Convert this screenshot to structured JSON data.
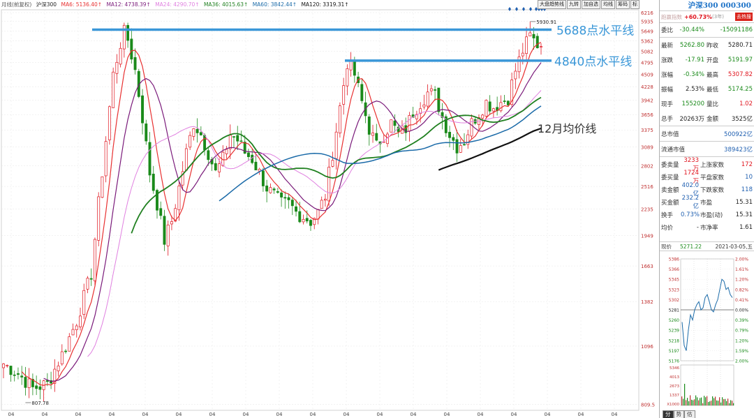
{
  "legend": {
    "label": "月线(前复权)",
    "index_name": "沪深300",
    "mas": [
      {
        "text": "MA6: 5136.40↑",
        "color": "#e83030"
      },
      {
        "text": "MA12: 4738.39↑",
        "color": "#7a1a7a"
      },
      {
        "text": "MA24: 4290.70↑",
        "color": "#e080e0"
      },
      {
        "text": "MA36: 4015.63↑",
        "color": "#208020"
      },
      {
        "text": "MA60: 3842.44↑",
        "color": "#1a6aa8"
      },
      {
        "text": "MA120: 3319.31↑",
        "color": "#111111"
      }
    ]
  },
  "toolbar": [
    "大盘趋势线",
    "九转",
    "加自选",
    "均线",
    "筹码",
    "标"
  ],
  "price_axis": [
    "6216",
    "5935",
    "5649",
    "5362",
    "5082",
    "4795",
    "4509",
    "4228",
    "3942",
    "3656",
    "3375",
    "3089",
    "2802",
    "2516",
    "2235",
    "1949",
    "1663",
    "1382",
    "1096",
    "809.5"
  ],
  "time_axis": [
    "04",
    "04",
    "04",
    "04",
    "04",
    "04",
    "04",
    "04",
    "04",
    "04",
    "04",
    "04",
    "04",
    "04",
    "04",
    "04",
    "04",
    "04",
    "04"
  ],
  "annotations": {
    "high_label": "5930.91",
    "low_label": "807.78",
    "level_1": "5688点水平线",
    "level_2": "4840点水平线",
    "ma_note": "12月均价线"
  },
  "chart_data": {
    "type": "candlestick",
    "title": "",
    "ylim": [
      807.78,
      6216
    ],
    "y_scale": "log",
    "horizontal_lines": [
      {
        "label": "5688点水平线",
        "y": 5688,
        "color": "#3a97d8"
      },
      {
        "label": "4840点水平线",
        "y": 4840,
        "color": "#3a97d8"
      }
    ],
    "extremes": {
      "high": 5930.91,
      "low": 807.78
    },
    "close_path": [
      [
        0,
        1000
      ],
      [
        4,
        950
      ],
      [
        8,
        880
      ],
      [
        12,
        900
      ],
      [
        16,
        1050
      ],
      [
        20,
        1250
      ],
      [
        24,
        1600
      ],
      [
        26,
        2300
      ],
      [
        28,
        3200
      ],
      [
        30,
        4500
      ],
      [
        32,
        5300
      ],
      [
        33,
        5600
      ],
      [
        34,
        5400
      ],
      [
        36,
        4600
      ],
      [
        38,
        3600
      ],
      [
        40,
        2700
      ],
      [
        42,
        2300
      ],
      [
        44,
        1900
      ],
      [
        46,
        2100
      ],
      [
        48,
        2500
      ],
      [
        50,
        3000
      ],
      [
        52,
        3500
      ],
      [
        54,
        3300
      ],
      [
        56,
        3000
      ],
      [
        58,
        2700
      ],
      [
        60,
        2900
      ],
      [
        62,
        3300
      ],
      [
        64,
        3200
      ],
      [
        66,
        3000
      ],
      [
        68,
        2900
      ],
      [
        70,
        2700
      ],
      [
        72,
        2500
      ],
      [
        74,
        2400
      ],
      [
        76,
        2300
      ],
      [
        78,
        2300
      ],
      [
        80,
        2200
      ],
      [
        82,
        2150
      ],
      [
        84,
        2100
      ],
      [
        86,
        2200
      ],
      [
        88,
        2400
      ],
      [
        90,
        3000
      ],
      [
        92,
        3800
      ],
      [
        94,
        4800
      ],
      [
        96,
        4500
      ],
      [
        98,
        3900
      ],
      [
        100,
        3400
      ],
      [
        102,
        3100
      ],
      [
        104,
        3300
      ],
      [
        106,
        3500
      ],
      [
        108,
        3300
      ],
      [
        110,
        3400
      ],
      [
        112,
        3700
      ],
      [
        114,
        3900
      ],
      [
        116,
        4100
      ],
      [
        118,
        4050
      ],
      [
        120,
        3600
      ],
      [
        122,
        3300
      ],
      [
        124,
        3100
      ],
      [
        126,
        3200
      ],
      [
        128,
        3500
      ],
      [
        130,
        3700
      ],
      [
        132,
        3900
      ],
      [
        134,
        3800
      ],
      [
        136,
        3900
      ],
      [
        138,
        4000
      ],
      [
        140,
        4600
      ],
      [
        142,
        5100
      ],
      [
        144,
        5500
      ],
      [
        146,
        5270
      ]
    ],
    "series": [
      {
        "name": "MA6",
        "value": 5136.4,
        "color": "#e83030"
      },
      {
        "name": "MA12",
        "value": 4738.39,
        "color": "#7a1a7a"
      },
      {
        "name": "MA24",
        "value": 4290.7,
        "color": "#e080e0"
      },
      {
        "name": "MA36",
        "value": 4015.63,
        "color": "#208020"
      },
      {
        "name": "MA60",
        "value": 3842.44,
        "color": "#1a6aa8"
      },
      {
        "name": "MA120",
        "value": 3319.31,
        "color": "#111111"
      }
    ]
  },
  "quote": {
    "header": "沪深300 000300",
    "sub_label": "跑赢指数",
    "sub_change": "+60.73%",
    "sub_period": "(3年)",
    "sub_btn": "去热搜",
    "weibi_label": "委比",
    "weibi_value": "-30.44%",
    "weibi_value2": "-15091186",
    "rows": [
      {
        "l": "最新",
        "v": "5262.80",
        "vc": "green",
        "l2": "昨收",
        "v2": "5280.71",
        "v2c": "dark"
      },
      {
        "l": "涨跌",
        "v": "-17.91",
        "vc": "green",
        "l2": "开盘",
        "v2": "5191.97",
        "v2c": "green"
      },
      {
        "l": "涨幅",
        "v": "-0.34%",
        "vc": "green",
        "l2": "最高",
        "v2": "5307.82",
        "v2c": "red"
      },
      {
        "l": "振幅",
        "v": "2.53%",
        "vc": "dark",
        "l2": "最低",
        "v2": "5174.25",
        "v2c": "green"
      },
      {
        "l": "现手",
        "v": "155200",
        "vc": "green",
        "l2": "量比",
        "v2": "1.02",
        "v2c": "red"
      },
      {
        "l": "总手",
        "v": "20263万",
        "vc": "dark",
        "l2": "金额",
        "v2": "3525亿",
        "v2c": "dark"
      }
    ],
    "market_cap_label": "总市值",
    "market_cap_value": "500922亿",
    "float_cap_label": "流通市值",
    "float_cap_value": "389423亿",
    "grid": [
      {
        "l": "委卖量",
        "v": "3233万",
        "vc": "red",
        "l2": "上涨家数",
        "v2": "172",
        "v2c": "red"
      },
      {
        "l": "委买量",
        "v": "1724万",
        "vc": "red",
        "l2": "平盘家数",
        "v2": "10",
        "v2c": "blue"
      },
      {
        "l": "卖金额",
        "v": "402.0亿",
        "vc": "blue",
        "l2": "下跌家数",
        "v2": "118",
        "v2c": "blue"
      },
      {
        "l": "买金额",
        "v": "232.2亿",
        "vc": "blue",
        "l2": "市盈",
        "v2": "15.31",
        "v2c": "dark"
      },
      {
        "l": "换手",
        "v": "0.73%",
        "vc": "blue",
        "l2": "市盈(动)",
        "v2": "15.31",
        "v2c": "dark"
      },
      {
        "l": "均价",
        "v": "-",
        "vc": "dark",
        "l2": "市净率",
        "v2": "1.61",
        "v2c": "dark"
      }
    ],
    "mini_label": "现价",
    "mini_value": "5271.22",
    "mini_date": "2021-03-05,五",
    "mini_left_axis": [
      "5386",
      "5366",
      "5345",
      "5323",
      "5302",
      "5281",
      "5260",
      "5239",
      "5218",
      "5197",
      "5176"
    ],
    "mini_right_axis": [
      "2.00%",
      "1.61%",
      "1.20%",
      "0.82%",
      "0.41%",
      "0.00%",
      "0.39%",
      "0.79%",
      "1.20%",
      "1.59%",
      "2.00%"
    ],
    "mini_vol_axis": [
      "5346",
      "4013",
      "2673",
      "1337",
      "X1000"
    ],
    "tabs": [
      "分",
      "势",
      "估"
    ]
  },
  "colors": {
    "rise": "#e0141e",
    "fall": "#1a8a1a",
    "level_line": "#3a97d8",
    "grid": "#e6e6e6"
  }
}
